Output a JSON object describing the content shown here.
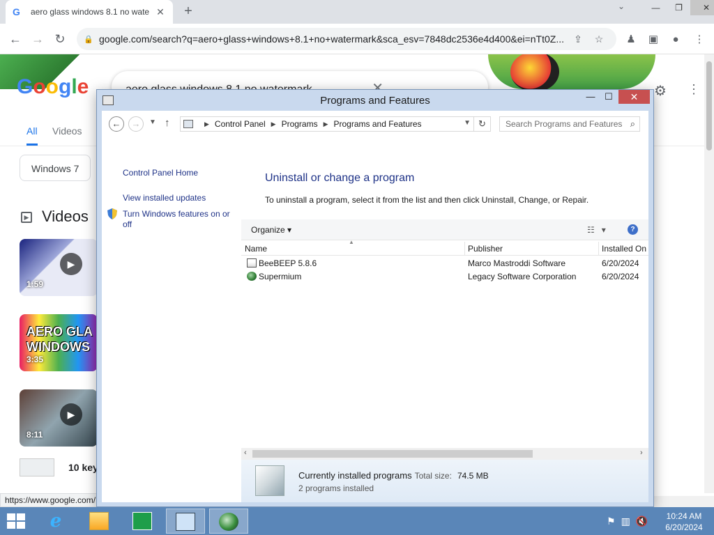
{
  "browser": {
    "tab_title": "aero glass windows 8.1 no wate",
    "url": "google.com/search?q=aero+glass+windows+8.1+no+watermark&sca_esv=7848dc2536e4d400&ei=nTt0Z...",
    "status_url": "https://www.google.com/"
  },
  "google": {
    "logo_letters": [
      "G",
      "o",
      "o",
      "g",
      "l",
      "e"
    ],
    "query": "aero glass windows 8.1 no watermark",
    "tabs": [
      "All",
      "Videos"
    ],
    "chip": "Windows 7",
    "videos_heading": "Videos",
    "videos": [
      {
        "duration": "1:59"
      },
      {
        "duration": "3:35",
        "thumb_text": "AERO GLA WINDOWS"
      },
      {
        "duration": "8:11"
      }
    ],
    "next_video_title": "10 key"
  },
  "window": {
    "title": "Programs and Features",
    "breadcrumb": [
      "Control Panel",
      "Programs",
      "Programs and Features"
    ],
    "search_placeholder": "Search Programs and Features",
    "left_links": [
      "Control Panel Home",
      "View installed updates",
      "Turn Windows features on or off"
    ],
    "heading": "Uninstall or change a program",
    "description": "To uninstall a program, select it from the list and then click Uninstall, Change, or Repair.",
    "organize_label": "Organize",
    "columns": [
      "Name",
      "Publisher",
      "Installed On"
    ],
    "programs": [
      {
        "name": "BeeBEEP 5.8.6",
        "publisher": "Marco Mastroddi Software",
        "installed_on": "6/20/2024",
        "icon": "beebeep-icon"
      },
      {
        "name": "Supermium",
        "publisher": "Legacy Software Corporation",
        "installed_on": "6/20/2024",
        "icon": "supermium-icon"
      }
    ],
    "details": {
      "title": "Currently installed programs",
      "total_size_label": "Total size:",
      "total_size_value": "74.5 MB",
      "count_text": "2 programs installed"
    }
  },
  "taskbar": {
    "time": "10:24 AM",
    "date": "6/20/2024",
    "colors": {
      "bar": "#5a86b8"
    }
  }
}
